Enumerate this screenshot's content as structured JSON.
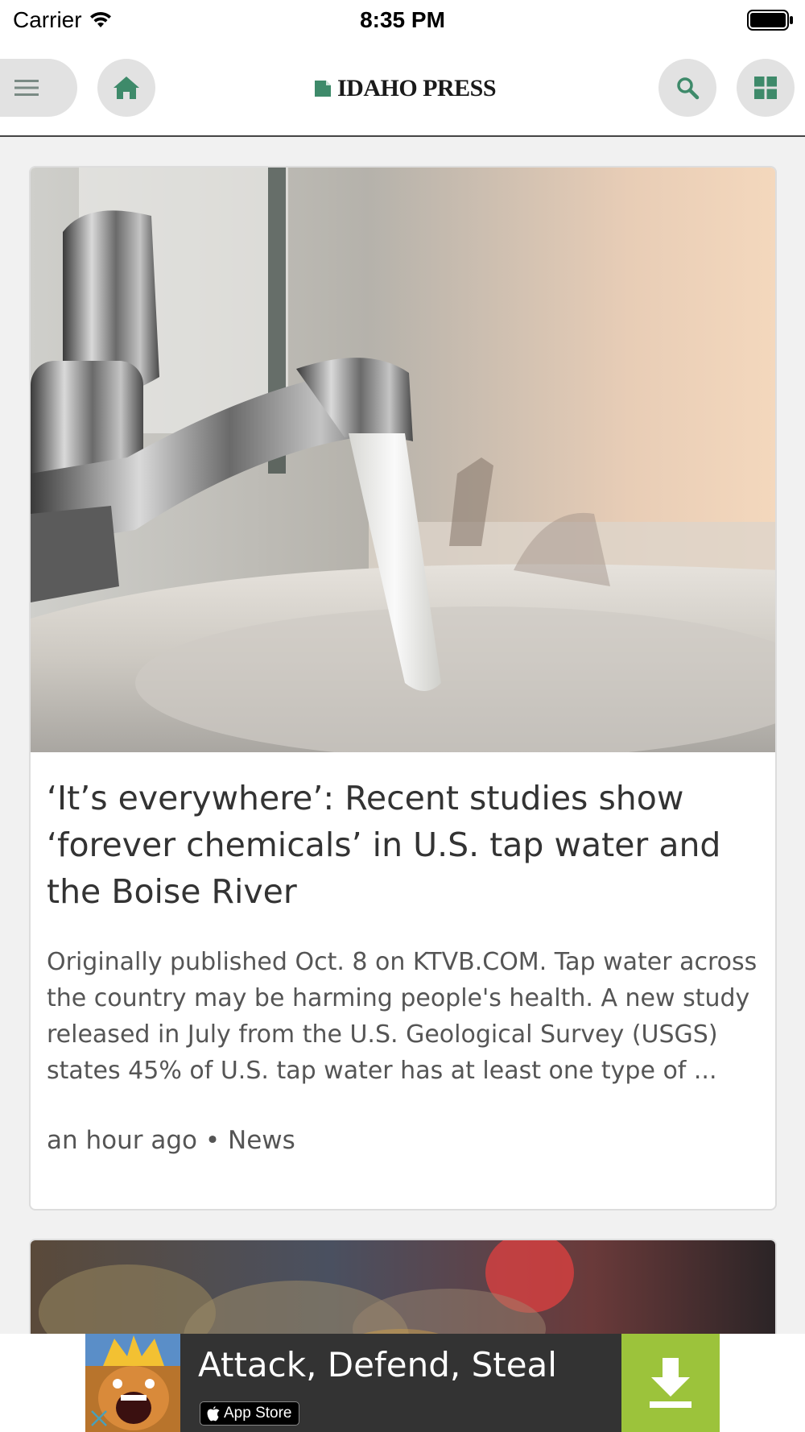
{
  "status_bar": {
    "carrier": "Carrier",
    "time": "8:35 PM"
  },
  "header": {
    "logo_text": "IDAHO PRESS",
    "brand_color": "#3e8a6a",
    "icons": [
      "menu-icon",
      "home-icon",
      "search-icon",
      "grid-icon"
    ]
  },
  "article": {
    "headline": "‘It’s everywhere’: Recent studies show ‘forever chemicals’ in U.S. tap water and the Boise River",
    "summary": "Originally published Oct. 8 on KTVB.COM. Tap water across the country may be harming people's health. A new study released in July from the U.S. Geological Survey (USGS) states 45% of U.S. tap water has at least one type of ...",
    "time": "an hour ago",
    "separator": "•",
    "section": "News",
    "image": "bathroom faucet with running water"
  },
  "ad": {
    "title": "Attack, Defend, Steal",
    "store_label": "App Store",
    "accent_color": "#9cc33b"
  }
}
